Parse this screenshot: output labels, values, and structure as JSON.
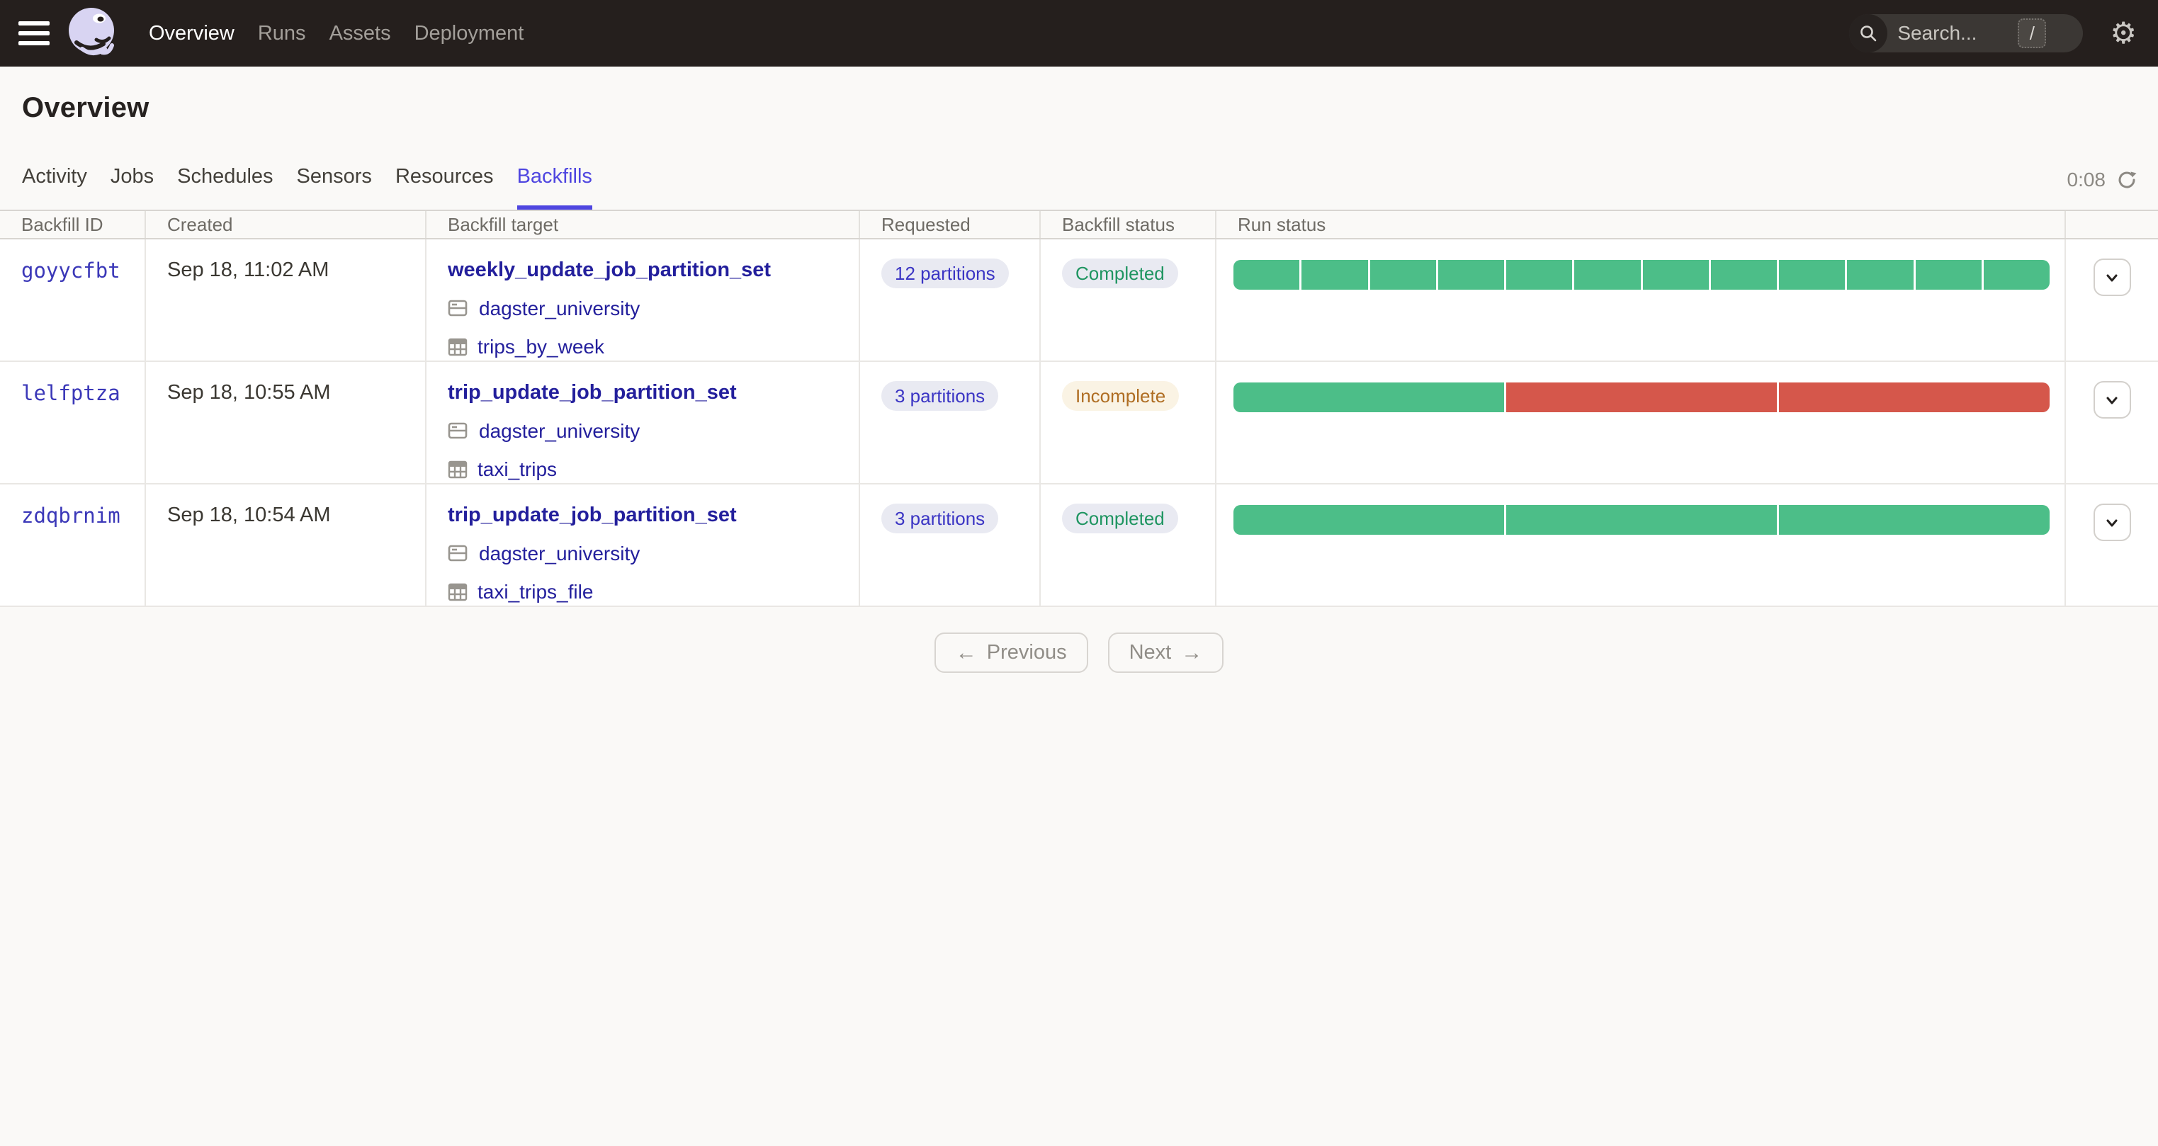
{
  "topbar": {
    "nav": [
      {
        "label": "Overview",
        "active": true
      },
      {
        "label": "Runs",
        "active": false
      },
      {
        "label": "Assets",
        "active": false
      },
      {
        "label": "Deployment",
        "active": false
      }
    ],
    "search": {
      "placeholder": "Search...",
      "shortcut": "/"
    }
  },
  "page": {
    "title": "Overview"
  },
  "tabs": [
    {
      "label": "Activity",
      "active": false
    },
    {
      "label": "Jobs",
      "active": false
    },
    {
      "label": "Schedules",
      "active": false
    },
    {
      "label": "Sensors",
      "active": false
    },
    {
      "label": "Resources",
      "active": false
    },
    {
      "label": "Backfills",
      "active": true
    }
  ],
  "refresh": {
    "countdown": "0:08"
  },
  "table": {
    "columns": [
      "Backfill ID",
      "Created",
      "Backfill target",
      "Requested",
      "Backfill status",
      "Run status"
    ],
    "rows": [
      {
        "id": "goyycfbt",
        "created": "Sep 18, 11:02 AM",
        "target": {
          "name": "weekly_update_job_partition_set",
          "repo": "dagster_university",
          "partition_set": "trips_by_week"
        },
        "requested": "12 partitions",
        "status": "Completed",
        "status_kind": "completed",
        "run_segments": [
          "success",
          "success",
          "success",
          "success",
          "success",
          "success",
          "success",
          "success",
          "success",
          "success",
          "success",
          "success"
        ]
      },
      {
        "id": "lelfptza",
        "created": "Sep 18, 10:55 AM",
        "target": {
          "name": "trip_update_job_partition_set",
          "repo": "dagster_university",
          "partition_set": "taxi_trips"
        },
        "requested": "3 partitions",
        "status": "Incomplete",
        "status_kind": "incomplete",
        "run_segments": [
          "success",
          "failure",
          "failure"
        ]
      },
      {
        "id": "zdqbrnim",
        "created": "Sep 18, 10:54 AM",
        "target": {
          "name": "trip_update_job_partition_set",
          "repo": "dagster_university",
          "partition_set": "taxi_trips_file"
        },
        "requested": "3 partitions",
        "status": "Completed",
        "status_kind": "completed",
        "run_segments": [
          "success",
          "success",
          "success"
        ]
      }
    ]
  },
  "pagination": {
    "previous_label": "Previous",
    "next_label": "Next",
    "left_arrow": "←",
    "right_arrow": "→"
  },
  "colors": {
    "success": "#4CBE88",
    "failure": "#D5574B",
    "accent": "#4F46E0",
    "topbar_bg": "#251F1D"
  }
}
